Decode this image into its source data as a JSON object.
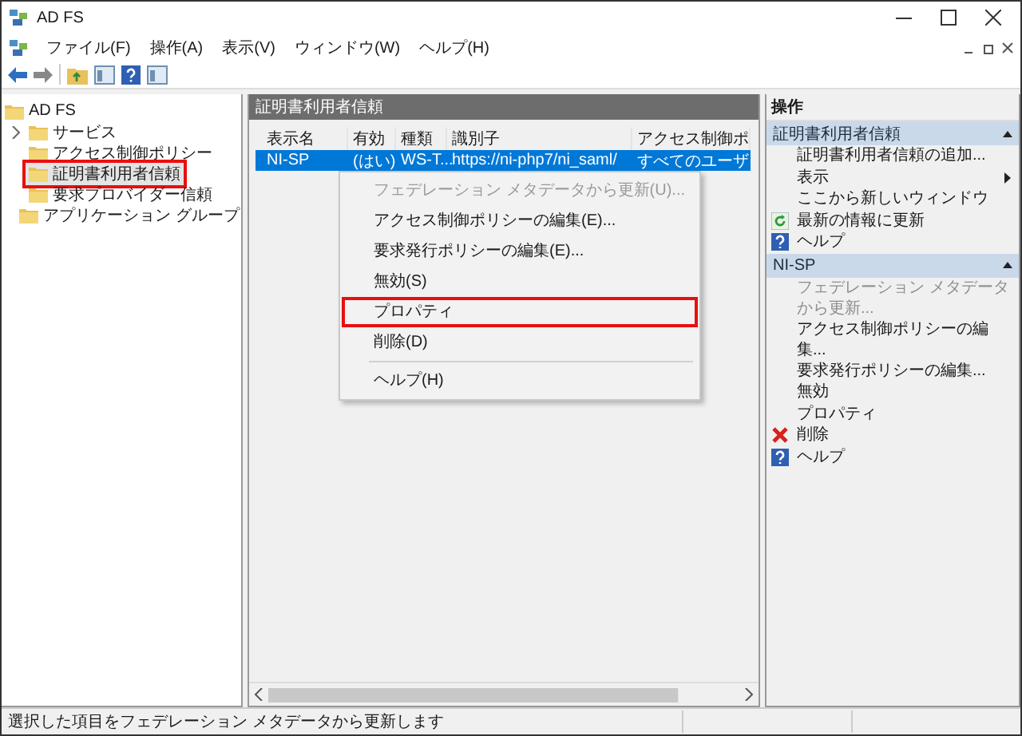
{
  "window": {
    "title": "AD FS"
  },
  "menu_bar": [
    "ファイル(F)",
    "操作(A)",
    "表示(V)",
    "ウィンドウ(W)",
    "ヘルプ(H)"
  ],
  "tree": {
    "label": "AD FS",
    "children": [
      {
        "label": "サービス",
        "expanded": false,
        "highlighted": false
      },
      {
        "label": "アクセス制御ポリシー",
        "highlighted": false
      },
      {
        "label": "証明書利用者信頼",
        "highlighted": true
      },
      {
        "label": "要求プロバイダー信頼",
        "highlighted": false
      },
      {
        "label": "アプリケーション グループ",
        "highlighted": false
      }
    ]
  },
  "center_panel": {
    "title": "証明書利用者信頼",
    "columns": [
      "表示名",
      "有効",
      "種類",
      "識別子",
      "アクセス制御ポ"
    ],
    "rows": [
      {
        "cells": [
          "NI-SP",
          "(はい)",
          "WS-T...",
          "https://ni-php7/ni_saml/",
          "すべてのユーザ"
        ],
        "selected": true
      }
    ]
  },
  "context_menu": [
    {
      "kind": "item",
      "label": "フェデレーション メタデータから更新(U)...",
      "disabled": true,
      "highlighted": false
    },
    {
      "kind": "item",
      "label": "アクセス制御ポリシーの編集(E)...",
      "disabled": false,
      "highlighted": false
    },
    {
      "kind": "item",
      "label": "要求発行ポリシーの編集(E)...",
      "disabled": false,
      "highlighted": false
    },
    {
      "kind": "item",
      "label": "無効(S)",
      "disabled": false,
      "highlighted": false
    },
    {
      "kind": "item",
      "label": "プロパティ",
      "disabled": false,
      "highlighted": true
    },
    {
      "kind": "item",
      "label": "削除(D)",
      "disabled": false,
      "highlighted": false
    },
    {
      "kind": "separator"
    },
    {
      "kind": "item",
      "label": "ヘルプ(H)",
      "disabled": false,
      "highlighted": false
    }
  ],
  "actions_pane": {
    "title": "操作",
    "sections": [
      {
        "title": "証明書利用者信頼",
        "expanded": true,
        "items": [
          {
            "kind": "plain",
            "label": "証明書利用者信頼の追加...",
            "disabled": false
          },
          {
            "kind": "submenu",
            "label": "表示",
            "disabled": false
          },
          {
            "kind": "plain",
            "label": "ここから新しいウィンドウ",
            "disabled": false
          },
          {
            "kind": "refresh",
            "label": "最新の情報に更新",
            "disabled": false
          },
          {
            "kind": "help",
            "label": "ヘルプ",
            "disabled": false
          }
        ]
      },
      {
        "title": "NI-SP",
        "expanded": true,
        "items": [
          {
            "kind": "plain",
            "label": "フェデレーション メタデータから更新...",
            "disabled": true
          },
          {
            "kind": "plain",
            "label": "アクセス制御ポリシーの編集...",
            "disabled": false
          },
          {
            "kind": "plain",
            "label": "要求発行ポリシーの編集...",
            "disabled": false
          },
          {
            "kind": "plain",
            "label": "無効",
            "disabled": false
          },
          {
            "kind": "plain",
            "label": "プロパティ",
            "disabled": false
          },
          {
            "kind": "delete",
            "label": "削除",
            "disabled": false
          },
          {
            "kind": "help",
            "label": "ヘルプ",
            "disabled": false
          }
        ]
      }
    ]
  },
  "status_bar": "選択した項目をフェデレーション メタデータから更新します"
}
